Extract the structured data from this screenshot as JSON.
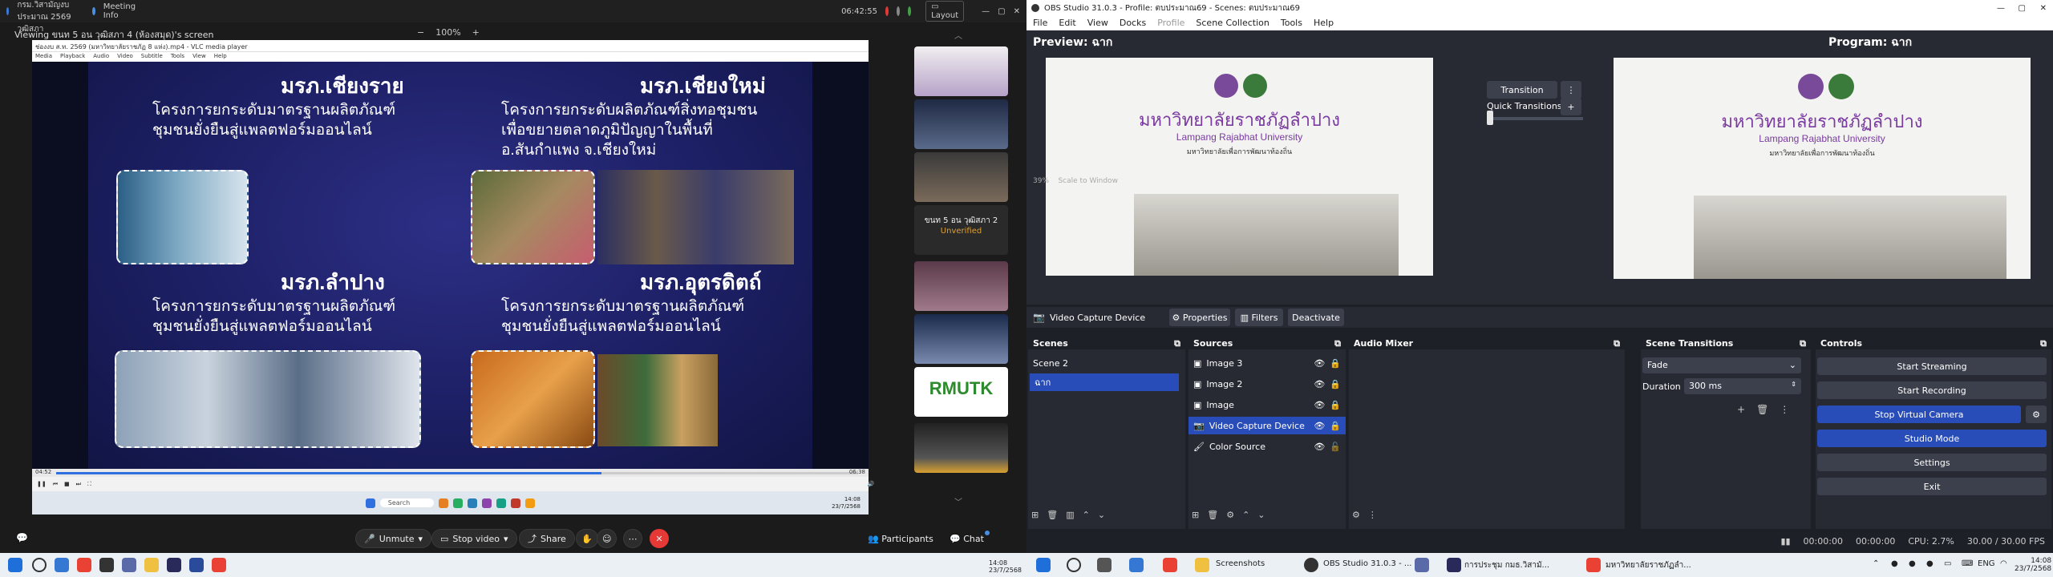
{
  "meeting": {
    "title": "การประชุม กรม.วิสามัญงบประมาณ 2569 วุฒิสภา",
    "meeting_info": "Meeting Info",
    "time": "06:42:55",
    "layout": "Layout",
    "viewing": "Viewing ขนท 5 อน วุฒิสภา 4 (ห้องสมุด)'s screen",
    "zoom": "100%",
    "vlc_title": "ช่องงบ ส.ท. 2569 (มหาวิทยาลัยราชภัฏ 8 แห่ง).mp4 - VLC media player",
    "vlc_menu": [
      "Media",
      "Playback",
      "Audio",
      "Video",
      "Subtitle",
      "Tools",
      "View",
      "Help"
    ],
    "vlc_time_left": "04:52",
    "vlc_time_right": "06:38",
    "search": "Search",
    "slide": {
      "u1": "มรภ.เชียงราย",
      "p1": [
        "โครงการยกระดับมาตรฐานผลิตภัณฑ์",
        "ชุมชนยั่งยืนสู่แพลตฟอร์มออนไลน์"
      ],
      "u2": "มรภ.เชียงใหม่",
      "p2": [
        "โครงการยกระดับผลิตภัณฑ์สิ่งทอชุมชน",
        "เพื่อขยายตลาดภูมิปัญญาในพื้นที่",
        "อ.สันกำแพง จ.เชียงใหม่"
      ],
      "u3": "มรภ.ลำปาง",
      "p3": [
        "โครงการยกระดับมาตรฐานผลิตภัณฑ์",
        "ชุมชนยั่งยืนสู่แพลตฟอร์มออนไลน์"
      ],
      "u4": "มรภ.อุตรดิตถ์",
      "p4": [
        "โครงการยกระดับมาตรฐานผลิตภัณฑ์",
        "ชุมชนยั่งยืนสู่แพลตฟอร์มออนไลน์"
      ]
    },
    "thumb_label": "ขนท 5 อน วุฒิสภา 2",
    "thumb_status": "Unverified",
    "rmutk": "RMUTK",
    "buttons": {
      "unmute": "Unmute",
      "stop_video": "Stop video",
      "share": "Share",
      "participants": "Participants",
      "chat": "Chat"
    },
    "inner_clock": "14:08",
    "inner_date": "23/7/2568"
  },
  "obs": {
    "title": "OBS Studio 31.0.3 - Profile: ตบประมาณ69 - Scenes: ตบประมาณ69",
    "menu": [
      "File",
      "Edit",
      "View",
      "Docks",
      "Profile",
      "Scene Collection",
      "Tools",
      "Help"
    ],
    "preview_label": "Preview: ฉาก",
    "program_label": "Program: ฉาก",
    "zoom_pct": "39%",
    "scale": "Scale to Window",
    "transition": "Transition",
    "quick": "Quick Transitions",
    "stage": {
      "th": "มหาวิทยาลัยราชภัฏลำปาง",
      "en": "Lampang Rajabhat University",
      "sub": "มหาวิทยาลัยเพื่อการพัฒนาท้องถิ่น"
    },
    "source_name": "Video Capture Device",
    "tool_props": "Properties",
    "tool_filters": "Filters",
    "tool_deactivate": "Deactivate",
    "docks": {
      "scenes": "Scenes",
      "sources": "Sources",
      "mixer": "Audio Mixer",
      "transitions": "Scene Transitions",
      "controls": "Controls"
    },
    "scenes": [
      "Scene 2",
      "ฉาก"
    ],
    "sources": [
      "Image 3",
      "Image 2",
      "Image",
      "Video Capture Device",
      "Color Source"
    ],
    "fade": "Fade",
    "duration_label": "Duration",
    "duration": "300 ms",
    "controls": [
      "Start Streaming",
      "Start Recording",
      "Stop Virtual Camera",
      "Studio Mode",
      "Settings",
      "Exit"
    ],
    "status": {
      "t1": "00:00:00",
      "t2": "00:00:00",
      "cpu": "CPU: 2.7%",
      "fps": "30.00 / 30.00 FPS"
    }
  },
  "taskbar": {
    "items": [
      "Screenshots",
      "OBS Studio 31.0.3 - ...",
      "การประชุม กมธ.วิสามั...",
      "มหาวิทยาลัยราชภัฏลำ..."
    ],
    "lang": "ENG",
    "time": "14:08",
    "date": "23/7/2568",
    "left_time": "14:08",
    "left_date": "23/7/2568"
  }
}
